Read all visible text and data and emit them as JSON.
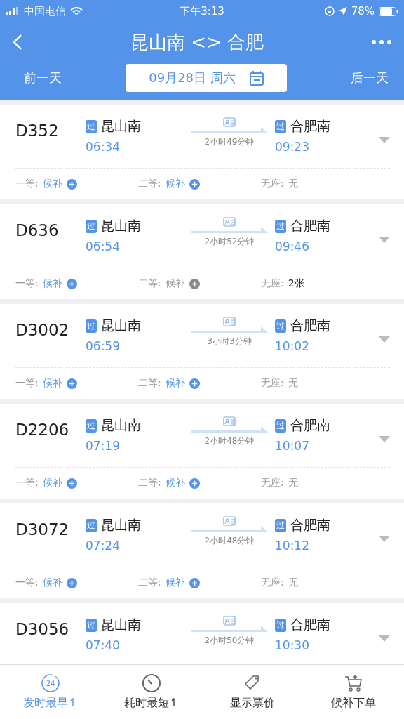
{
  "status_bar": {
    "carrier": "中国电信",
    "time": "下午3:13",
    "battery": "78%"
  },
  "header": {
    "title": "昆山南 <> 合肥",
    "prev_day": "前一天",
    "date": "09月28日 周六",
    "next_day": "后一天"
  },
  "trains": [
    {
      "number": "D352",
      "from": "昆山南",
      "from_tag": "过",
      "depart": "06:34",
      "duration": "2小时49分钟",
      "to": "合肥南",
      "to_tag": "过",
      "arrive": "09:23",
      "seats": [
        {
          "label": "一等:",
          "value": "候补",
          "kind": "waitlist",
          "available": true
        },
        {
          "label": "二等:",
          "value": "候补",
          "kind": "waitlist",
          "available": true
        },
        {
          "label": "无座:",
          "value": "无",
          "kind": "count",
          "available": false
        }
      ]
    },
    {
      "number": "D636",
      "from": "昆山南",
      "from_tag": "过",
      "depart": "06:54",
      "duration": "2小时52分钟",
      "to": "合肥南",
      "to_tag": "过",
      "arrive": "09:46",
      "seats": [
        {
          "label": "一等:",
          "value": "候补",
          "kind": "waitlist",
          "available": true
        },
        {
          "label": "二等:",
          "value": "候补",
          "kind": "waitlist",
          "available": false
        },
        {
          "label": "无座:",
          "value": "2张",
          "kind": "count",
          "available": true
        }
      ]
    },
    {
      "number": "D3002",
      "from": "昆山南",
      "from_tag": "过",
      "depart": "06:59",
      "duration": "3小时3分钟",
      "to": "合肥南",
      "to_tag": "过",
      "arrive": "10:02",
      "seats": [
        {
          "label": "一等:",
          "value": "候补",
          "kind": "waitlist",
          "available": true
        },
        {
          "label": "二等:",
          "value": "候补",
          "kind": "waitlist",
          "available": true
        },
        {
          "label": "无座:",
          "value": "无",
          "kind": "count",
          "available": false
        }
      ]
    },
    {
      "number": "D2206",
      "from": "昆山南",
      "from_tag": "过",
      "depart": "07:19",
      "duration": "2小时48分钟",
      "to": "合肥南",
      "to_tag": "过",
      "arrive": "10:07",
      "seats": [
        {
          "label": "一等:",
          "value": "候补",
          "kind": "waitlist",
          "available": true
        },
        {
          "label": "二等:",
          "value": "候补",
          "kind": "waitlist",
          "available": true
        },
        {
          "label": "无座:",
          "value": "无",
          "kind": "count",
          "available": false
        }
      ]
    },
    {
      "number": "D3072",
      "from": "昆山南",
      "from_tag": "过",
      "depart": "07:24",
      "duration": "2小时48分钟",
      "to": "合肥南",
      "to_tag": "过",
      "arrive": "10:12",
      "seats": [
        {
          "label": "一等:",
          "value": "候补",
          "kind": "waitlist",
          "available": true
        },
        {
          "label": "二等:",
          "value": "候补",
          "kind": "waitlist",
          "available": true
        },
        {
          "label": "无座:",
          "value": "无",
          "kind": "count",
          "available": false
        }
      ]
    },
    {
      "number": "D3056",
      "from": "昆山南",
      "from_tag": "过",
      "depart": "07:40",
      "duration": "2小时50分钟",
      "to": "合肥南",
      "to_tag": "过",
      "arrive": "10:30"
    }
  ],
  "bottom_bar": [
    {
      "label": "发时最早↿",
      "kind": "clock24",
      "icon_text": "24",
      "selected": true
    },
    {
      "label": "耗时最短↿",
      "kind": "timer",
      "selected": false
    },
    {
      "label": "显示票价",
      "kind": "tag",
      "selected": false
    },
    {
      "label": "候补下单",
      "kind": "cart",
      "selected": false
    }
  ]
}
